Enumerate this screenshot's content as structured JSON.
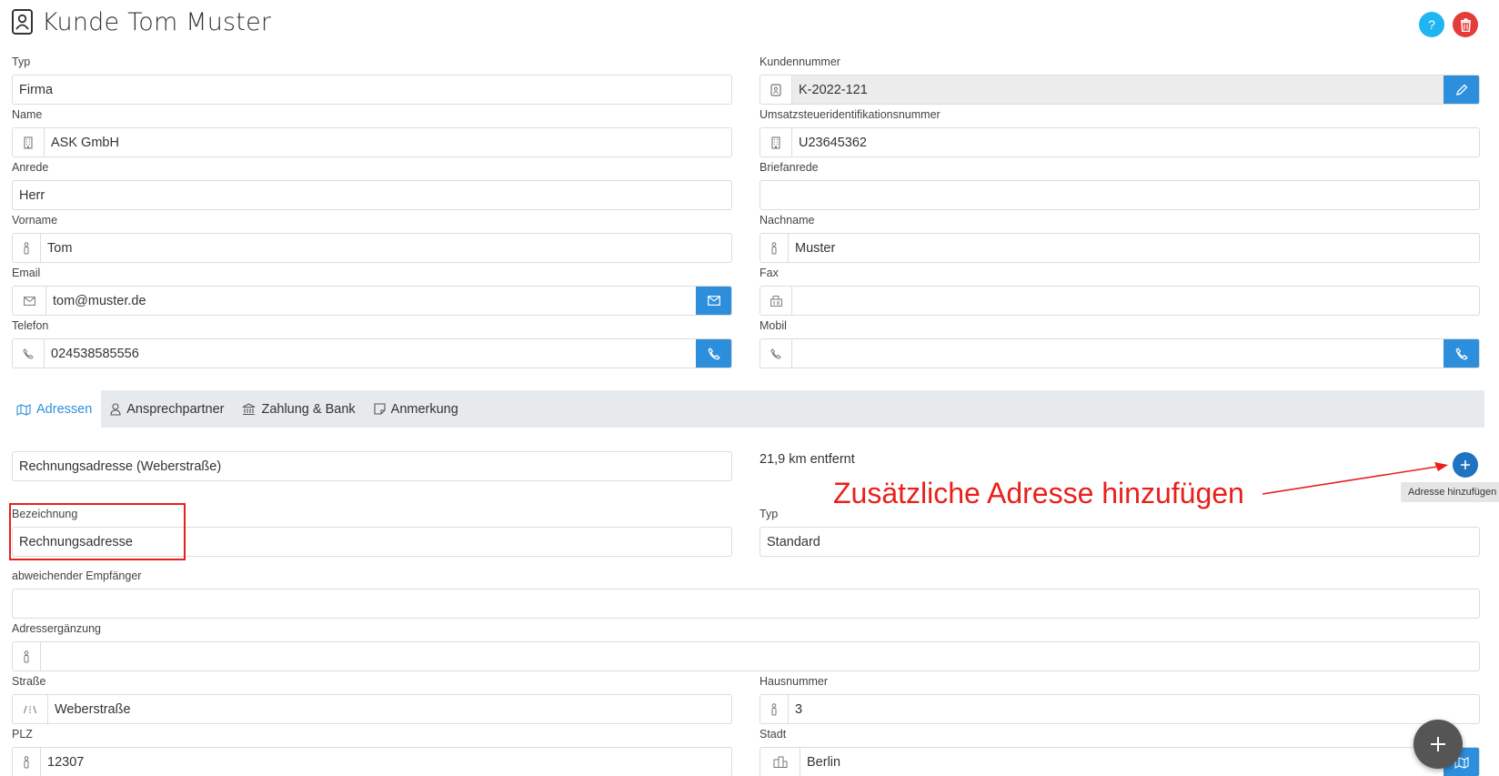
{
  "header": {
    "title": "Kunde Tom Muster",
    "help_label": "?"
  },
  "customer": {
    "typ": {
      "label": "Typ",
      "value": "Firma"
    },
    "kundennummer": {
      "label": "Kundennummer",
      "value": "K-2022-121"
    },
    "name": {
      "label": "Name",
      "value": "ASK GmbH"
    },
    "ustid": {
      "label": "Umsatzsteueridentifikationsnummer",
      "value": "U23645362"
    },
    "anrede": {
      "label": "Anrede",
      "value": "Herr"
    },
    "briefanrede": {
      "label": "Briefanrede",
      "value": ""
    },
    "vorname": {
      "label": "Vorname",
      "value": "Tom"
    },
    "nachname": {
      "label": "Nachname",
      "value": "Muster"
    },
    "email": {
      "label": "Email",
      "value": "tom@muster.de"
    },
    "fax": {
      "label": "Fax",
      "value": ""
    },
    "telefon": {
      "label": "Telefon",
      "value": "024538585556"
    },
    "mobil": {
      "label": "Mobil",
      "value": ""
    }
  },
  "tabs": [
    {
      "label": "Adressen",
      "icon": "map-icon",
      "active": true
    },
    {
      "label": "Ansprechpartner",
      "icon": "user-icon",
      "active": false
    },
    {
      "label": "Zahlung & Bank",
      "icon": "bank-icon",
      "active": false
    },
    {
      "label": "Anmerkung",
      "icon": "note-icon",
      "active": false
    }
  ],
  "address": {
    "selected": "Rechnungsadresse (Weberstraße)",
    "distance": "21,9 km entfernt",
    "add_tooltip": "Adresse hinzufügen",
    "bezeichnung": {
      "label": "Bezeichnung",
      "value": "Rechnungsadresse"
    },
    "typ": {
      "label": "Typ",
      "value": "Standard"
    },
    "empfaenger": {
      "label": "abweichender Empfänger",
      "value": ""
    },
    "zusatz": {
      "label": "Adressergänzung",
      "value": ""
    },
    "strasse": {
      "label": "Straße",
      "value": "Weberstraße"
    },
    "hausnummer": {
      "label": "Hausnummer",
      "value": "3"
    },
    "plz": {
      "label": "PLZ",
      "value": "12307"
    },
    "stadt": {
      "label": "Stadt",
      "value": "Berlin"
    }
  },
  "annotation": {
    "text": "Zusätzliche Adresse hinzufügen",
    "color": "#e8201c"
  },
  "colors": {
    "primary_button": "#2d8fdc",
    "help_button": "#1fb5f2",
    "delete_button": "#e53b3b",
    "tab_active_text": "#2d8fdc",
    "tabs_background": "#e7eaed"
  }
}
